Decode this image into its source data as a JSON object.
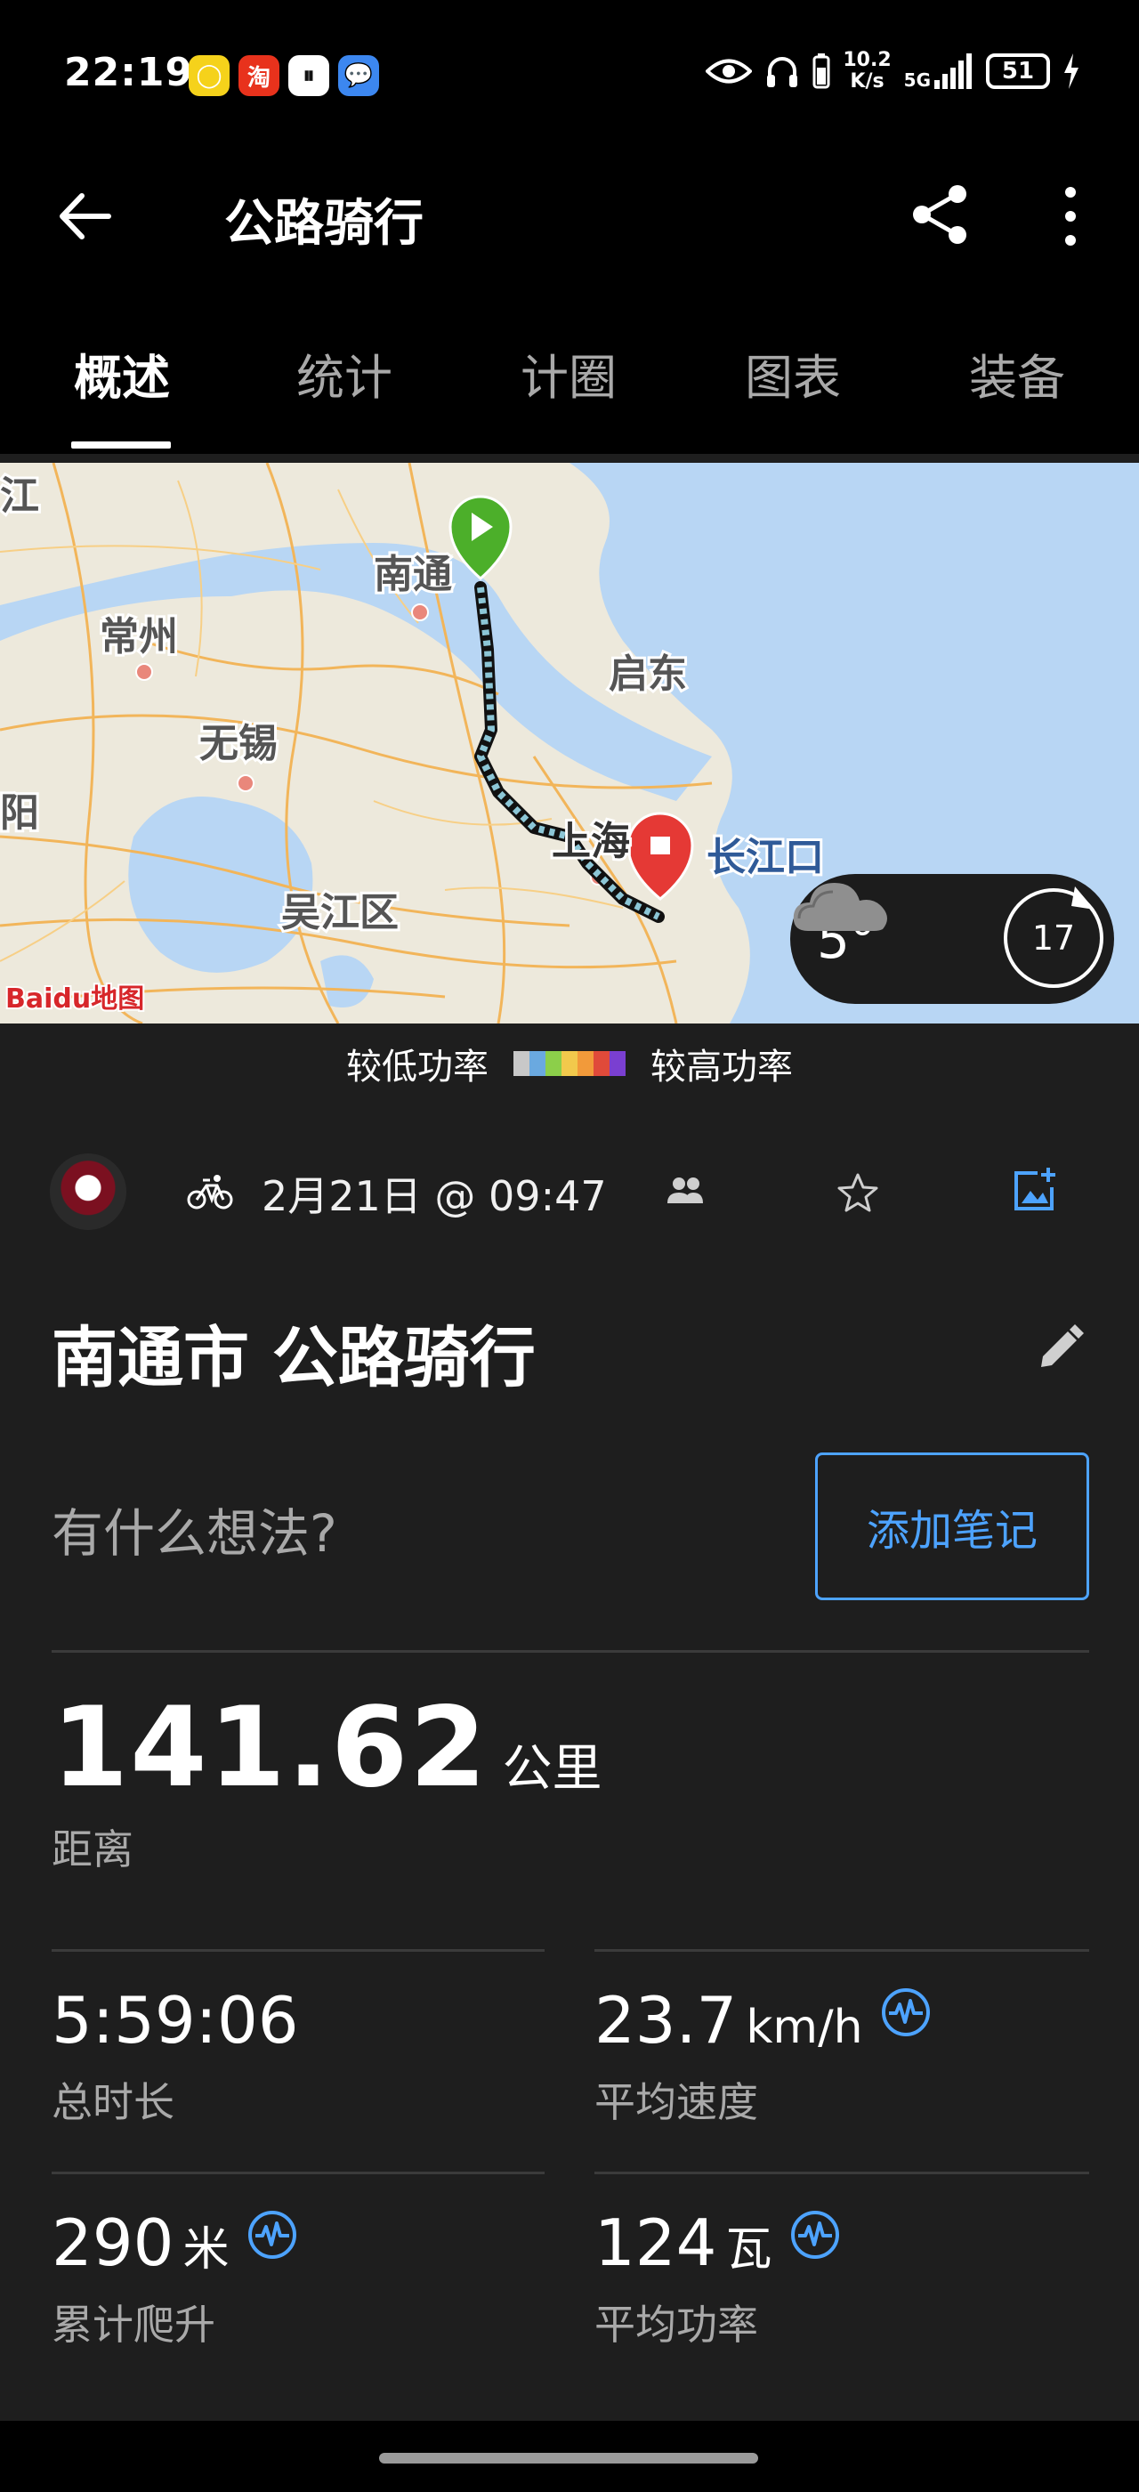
{
  "status_bar": {
    "time": "22:19",
    "notif_icons": [
      {
        "name": "app-yellow-icon",
        "glyph": "◯",
        "bg": "#f5d21b",
        "fg": "#ffffff"
      },
      {
        "name": "taobao-icon",
        "glyph": "淘",
        "bg": "#e8321c",
        "fg": "#ffffff"
      },
      {
        "name": "app-white-icon",
        "glyph": "⏸",
        "bg": "#ffffff",
        "fg": "#111111"
      },
      {
        "name": "message-icon",
        "glyph": "💬",
        "bg": "#3c87f0",
        "fg": "#ffffff"
      }
    ],
    "net_speed_value": "10.2",
    "net_speed_unit": "K/s",
    "network": "5G",
    "battery": "51"
  },
  "app_bar": {
    "title": "公路骑行"
  },
  "tabs": [
    "概述",
    "统计",
    "计圈",
    "图表",
    "装备"
  ],
  "map": {
    "labels": [
      {
        "text": "南通"
      },
      {
        "text": "常州"
      },
      {
        "text": "启东"
      },
      {
        "text": "无锡"
      },
      {
        "text": "吴江区"
      },
      {
        "text": "长江口"
      },
      {
        "text": "阳"
      },
      {
        "text": "江"
      },
      {
        "text": "上海"
      }
    ],
    "provider_logo": "Baidu地图",
    "weather": {
      "temp": "5°",
      "wind": "17"
    },
    "colors": {
      "water": "#b8d6f4",
      "land": "#ede9dc",
      "road": "#f2b55a",
      "start": "#4caf2a",
      "end": "#e53935"
    }
  },
  "legend": {
    "low": "较低功率",
    "high": "较高功率",
    "colors": [
      "#c8c8c8",
      "#6aa9e0",
      "#8ccf4a",
      "#f2c94c",
      "#f29a3a",
      "#e04a3a",
      "#7a3fd1"
    ]
  },
  "activity": {
    "date": "2月21日 @ 09:47",
    "title": "南通市 公路骑行",
    "thoughts_placeholder": "有什么想法?",
    "add_note_label": "添加笔记"
  },
  "stats": {
    "distance": {
      "value": "141.62",
      "unit": "公里",
      "label": "距离"
    },
    "total_time": {
      "value": "5:59:06",
      "unit": "",
      "label": "总时长"
    },
    "avg_speed": {
      "value": "23.7",
      "unit": "km/h",
      "label": "平均速度"
    },
    "elevation": {
      "value": "290",
      "unit": "米",
      "label": "累计爬升"
    },
    "avg_power": {
      "value": "124",
      "unit": "瓦",
      "label": "平均功率"
    }
  }
}
